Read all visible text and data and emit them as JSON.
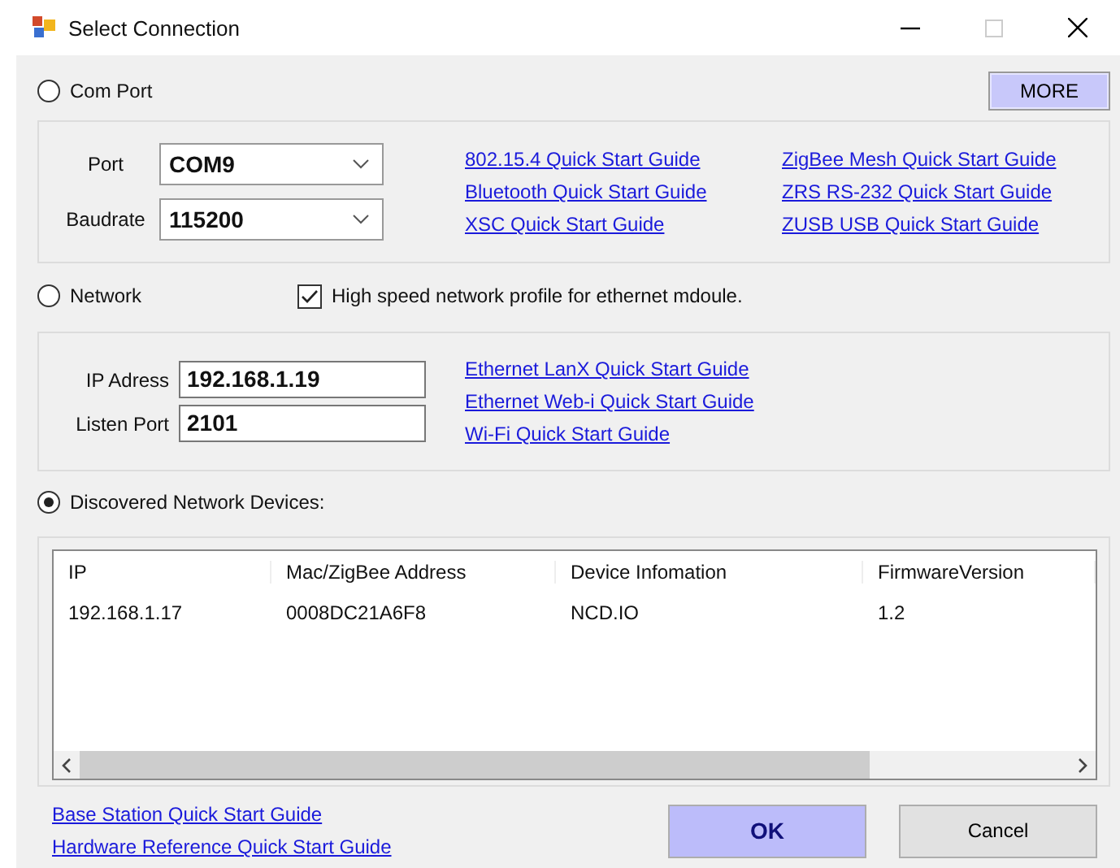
{
  "window": {
    "title": "Select Connection"
  },
  "com_port": {
    "label": "Com Port",
    "selected": false,
    "more_button": "MORE",
    "port_label": "Port",
    "port_value": "COM9",
    "baud_label": "Baudrate",
    "baud_value": "115200",
    "links": [
      "802.15.4 Quick Start Guide",
      "ZigBee Mesh Quick Start Guide",
      "Bluetooth Quick Start Guide",
      "ZRS RS-232 Quick Start Guide",
      "XSC Quick Start Guide",
      "ZUSB USB Quick Start Guide"
    ]
  },
  "network": {
    "label": "Network",
    "selected": false,
    "high_speed": {
      "label": "High speed network profile for ethernet mdoule.",
      "checked": true
    },
    "ip_label": "IP Adress",
    "ip_value": "192.168.1.19",
    "port_label": "Listen Port",
    "port_value": "2101",
    "links": [
      "Ethernet LanX Quick Start Guide",
      "Ethernet Web-i Quick Start Guide",
      "Wi-Fi Quick Start Guide"
    ]
  },
  "discovered": {
    "label": "Discovered Network Devices:",
    "selected": true,
    "columns": [
      "IP",
      "Mac/ZigBee Address",
      "Device Infomation",
      "FirmwareVersion"
    ],
    "rows": [
      [
        "192.168.1.17",
        "0008DC21A6F8",
        "NCD.IO",
        "1.2"
      ]
    ]
  },
  "footer_links": [
    "Base Station Quick Start Guide",
    "Hardware Reference Quick Start Guide"
  ],
  "buttons": [
    {
      "label": "OK",
      "kind": "primary"
    },
    {
      "label": "Cancel",
      "kind": "normal"
    }
  ]
}
